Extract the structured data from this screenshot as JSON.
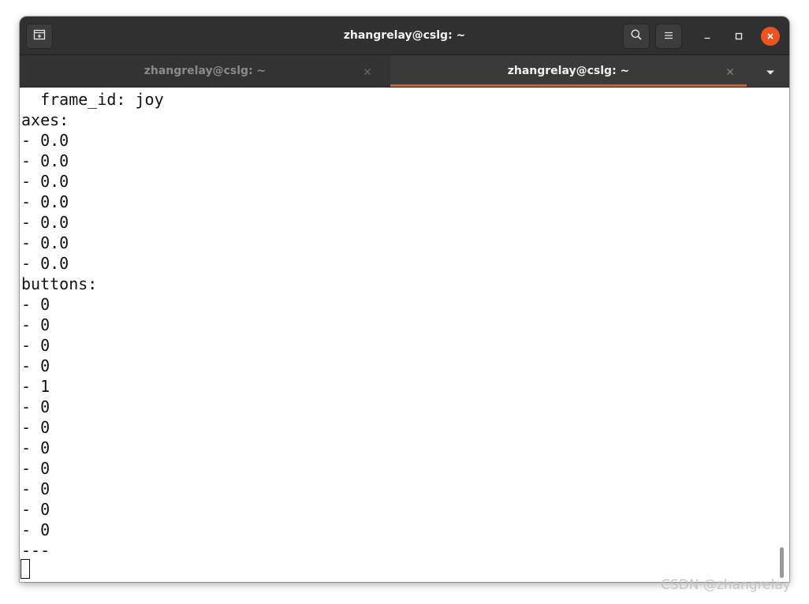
{
  "window": {
    "title": "zhangrelay@cslg: ~"
  },
  "header": {
    "new_tab_icon": "new-tab-icon",
    "search_icon": "search-icon",
    "menu_icon": "hamburger-menu-icon",
    "minimize_icon": "minimize-icon",
    "maximize_icon": "maximize-icon",
    "close_icon": "close-icon"
  },
  "tabs": [
    {
      "label": "zhangrelay@cslg: ~",
      "active": false
    },
    {
      "label": "zhangrelay@cslg: ~",
      "active": true
    }
  ],
  "colors": {
    "accent": "#e95420",
    "headerbar": "#303030",
    "terminal_bg": "#ffffff",
    "terminal_fg": "#111111"
  },
  "terminal": {
    "lines": [
      "  frame_id: joy",
      "axes:",
      "- 0.0",
      "- 0.0",
      "- 0.0",
      "- 0.0",
      "- 0.0",
      "- 0.0",
      "- 0.0",
      "buttons:",
      "- 0",
      "- 0",
      "- 0",
      "- 0",
      "- 1",
      "- 0",
      "- 0",
      "- 0",
      "- 0",
      "- 0",
      "- 0",
      "- 0",
      "---"
    ]
  },
  "watermark": "CSDN @zhangrelay"
}
